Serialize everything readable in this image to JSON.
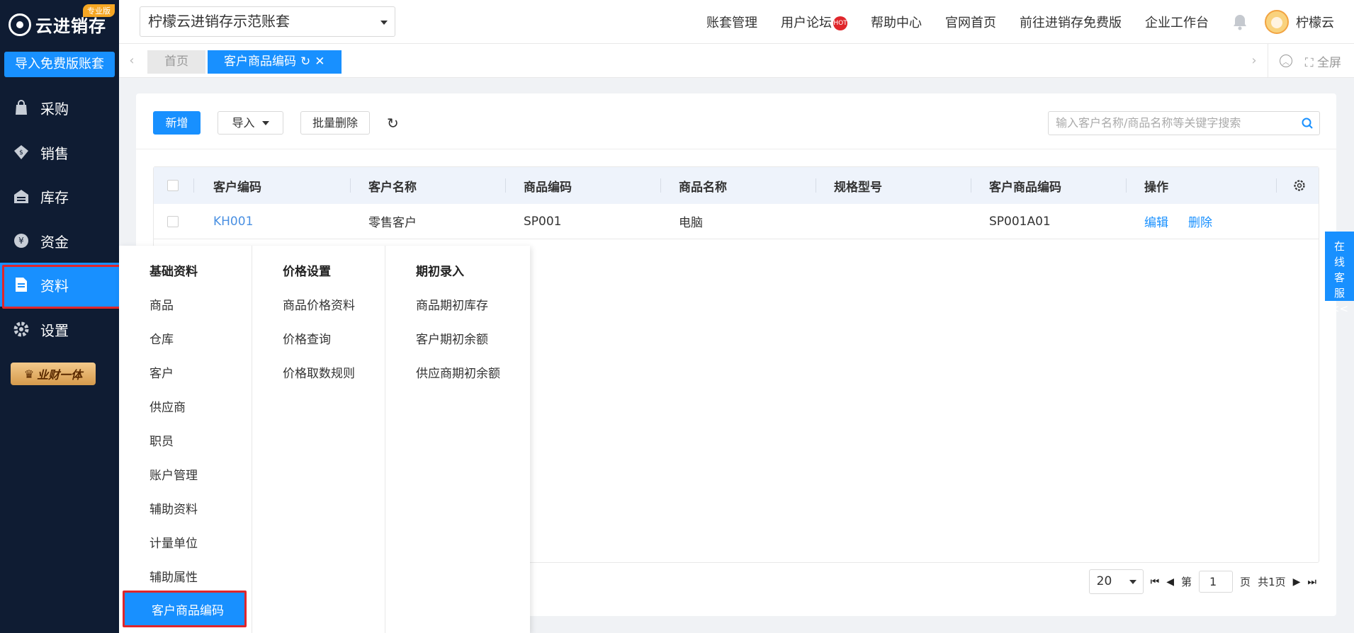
{
  "app": {
    "logo_text": "云进销存",
    "pro_badge": "专业版",
    "import_free_button": "导入免费版账套",
    "crown_badge": "业财一体"
  },
  "sidebar": {
    "items": [
      {
        "label": "采购",
        "icon": "bag-icon"
      },
      {
        "label": "销售",
        "icon": "sales-icon"
      },
      {
        "label": "库存",
        "icon": "warehouse-icon"
      },
      {
        "label": "资金",
        "icon": "yen-icon"
      },
      {
        "label": "资料",
        "icon": "document-icon",
        "active": true
      },
      {
        "label": "设置",
        "icon": "gear-icon"
      }
    ]
  },
  "header": {
    "account_selected": "柠檬云进销存示范账套",
    "nav": [
      "账套管理",
      "用户论坛",
      "帮助中心",
      "官网首页",
      "前往进销存免费版",
      "企业工作台"
    ],
    "hot_badge": "HOT",
    "username": "柠檬云"
  },
  "tabs": {
    "home": "首页",
    "current": "客户商品编码",
    "fullscreen": "全屏"
  },
  "toolbar": {
    "add": "新增",
    "import": "导入",
    "batch_delete": "批量删除"
  },
  "search": {
    "placeholder": "输入客户名称/商品名称等关键字搜索"
  },
  "table": {
    "columns": [
      "客户编码",
      "客户名称",
      "商品编码",
      "商品名称",
      "规格型号",
      "客户商品编码",
      "操作"
    ],
    "rows": [
      {
        "customer_code": "KH001",
        "customer_name": "零售客户",
        "product_code": "SP001",
        "product_name": "电脑",
        "spec": "",
        "customer_product_code": "SP001A01",
        "edit": "编辑",
        "delete": "删除"
      }
    ]
  },
  "pager": {
    "page_size": "20",
    "page_prefix": "第",
    "page_value": "1",
    "page_suffix": "页",
    "total": "共1页"
  },
  "service": [
    "在",
    "线",
    "客",
    "服",
    "<<"
  ],
  "flyout": {
    "col1": {
      "title": "基础资料",
      "items": [
        "商品",
        "仓库",
        "客户",
        "供应商",
        "职员",
        "账户管理",
        "辅助资料",
        "计量单位",
        "辅助属性",
        "客户商品编码"
      ]
    },
    "col2": {
      "title": "价格设置",
      "items": [
        "商品价格资料",
        "价格查询",
        "价格取数规则"
      ]
    },
    "col3": {
      "title": "期初录入",
      "items": [
        "商品期初库存",
        "客户期初余额",
        "供应商期初余额"
      ]
    }
  },
  "colors": {
    "sidebar_bg": "#0f1c33",
    "primary": "#1890ff",
    "highlight_border": "#e0262b"
  }
}
